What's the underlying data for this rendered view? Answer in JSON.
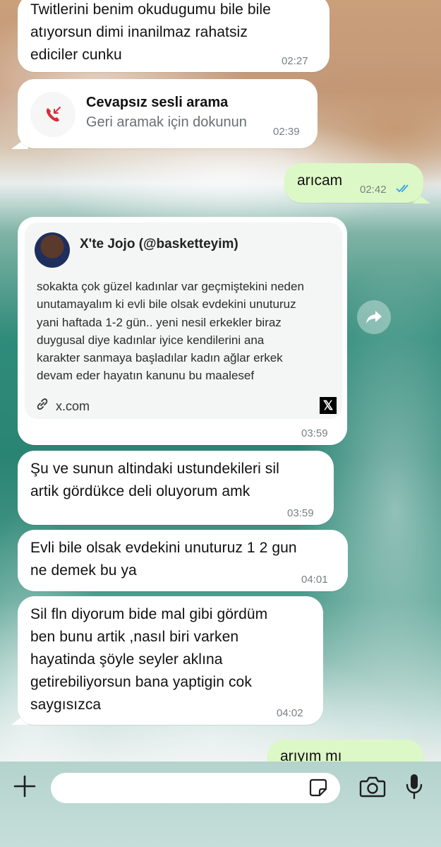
{
  "chat": {
    "msg1": {
      "text_lines": [
        "Twitlerini benim okudugumu bile bile",
        "atıyorsun dimi inanilmaz rahatsiz",
        "ediciler cunku"
      ],
      "time": "02:27"
    },
    "missed_call": {
      "title": "Cevapsız sesli arama",
      "subtitle": "Geri aramak için dokunun",
      "time": "02:39"
    },
    "msg_out1": {
      "text": "arıcam",
      "time": "02:42",
      "status": "read"
    },
    "link_preview": {
      "author": "X'te Jojo (@basketteyim)",
      "body_lines": [
        "sokakta çok güzel kadınlar var geçmiştekini neden",
        "unutamayalım ki evli bile olsak evdekini unuturuz",
        "yani haftada 1-2 gün.. yeni nesil erkekler biraz",
        "duygusal diye kadınlar iyice kendilerini ana",
        "karakter sanmaya başladılar kadın ağlar erkek",
        "devam eder hayatın kanunu bu maalesef"
      ],
      "domain": "x.com",
      "time": "03:59"
    },
    "msg2": {
      "text_lines": [
        "Şu ve sunun altindaki ustundekileri sil",
        "artik gördükce deli oluyorum amk"
      ],
      "time": "03:59"
    },
    "msg3": {
      "text_lines": [
        "Evli bile olsak evdekini unuturuz 1 2 gun",
        "ne demek bu ya"
      ],
      "time": "04:01"
    },
    "msg4": {
      "text_lines": [
        "Sil fln diyorum bide mal gibi gördüm",
        "ben bunu artik ,nasıl biri varken",
        "hayatinda şöyle seyler aklına",
        "getirebiliyorsun bana yaptigin cok",
        "saygısızca"
      ],
      "time": "04:02"
    },
    "msg_out2": {
      "text": "arıyım mı"
    }
  },
  "icons": {
    "plus": "plus-icon",
    "sticker": "sticker-icon",
    "camera": "camera-icon",
    "mic": "microphone-icon",
    "call": "missed-call-icon",
    "share": "forward-icon",
    "link": "link-icon",
    "x": "x-logo-icon"
  },
  "colors": {
    "incoming": "#ffffff",
    "outgoing": "#dcf8c6",
    "missed_call": "#d62d3a",
    "read_ticks": "#34a0e5"
  }
}
